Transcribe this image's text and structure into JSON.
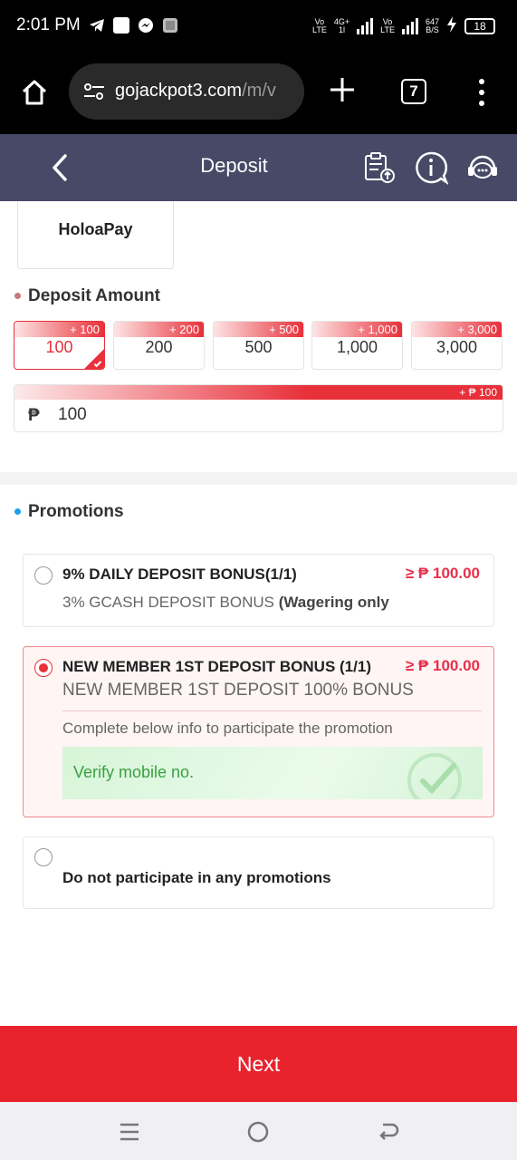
{
  "status_bar": {
    "time": "2:01 PM",
    "net1_top": "Vo",
    "net1_bottom": "LTE",
    "net2_top": "4G+",
    "net2_bottom": "1l",
    "net3_top": "Vo",
    "net3_bottom": "LTE",
    "speed_top": "647",
    "speed_bottom": "B/S",
    "battery": "18",
    "app_icons": [
      "telegram-icon",
      "app-square-icon",
      "messenger-icon",
      "photos-icon"
    ]
  },
  "browser": {
    "url_main": "gojackpot3.com",
    "url_rest": "/m/v",
    "tab_count": "7"
  },
  "header": {
    "title": "Deposit"
  },
  "payment_method": {
    "name": "HoloaPay"
  },
  "deposit_amount": {
    "title": "Deposit Amount",
    "options": [
      {
        "bonus": "+ 100",
        "value": "100"
      },
      {
        "bonus": "+ 200",
        "value": "200"
      },
      {
        "bonus": "+ 500",
        "value": "500"
      },
      {
        "bonus": "+ 1,000",
        "value": "1,000"
      },
      {
        "bonus": "+ 3,000",
        "value": "3,000"
      }
    ],
    "selected_index": 0,
    "input_bonus": "+ ₱ 100",
    "currency_symbol": "₱",
    "input_value": "100"
  },
  "promotions": {
    "title": "Promotions",
    "items": [
      {
        "title": "9% DAILY DEPOSIT BONUS(1/1)",
        "min": "≥ ₱ 100.00",
        "subtitle_plain": "3% GCASH DEPOSIT BONUS ",
        "subtitle_bold": "(Wagering only"
      },
      {
        "title": "NEW MEMBER 1ST DEPOSIT BONUS (1/1)",
        "min": "≥ ₱ 100.00",
        "subtitle": "NEW MEMBER 1ST DEPOSIT 100% BONUS",
        "info": "Complete below info to participate the promotion",
        "verify_label": "Verify mobile no."
      },
      {
        "title": "Do not participate in any promotions"
      }
    ],
    "selected_index": 1
  },
  "next_button": "Next",
  "colors": {
    "accent": "#e8303a",
    "header_bg": "#474a66",
    "promo_dot": "#1ea0e8",
    "amount_dot": "#c9787c",
    "verify_green": "#3aa040"
  }
}
